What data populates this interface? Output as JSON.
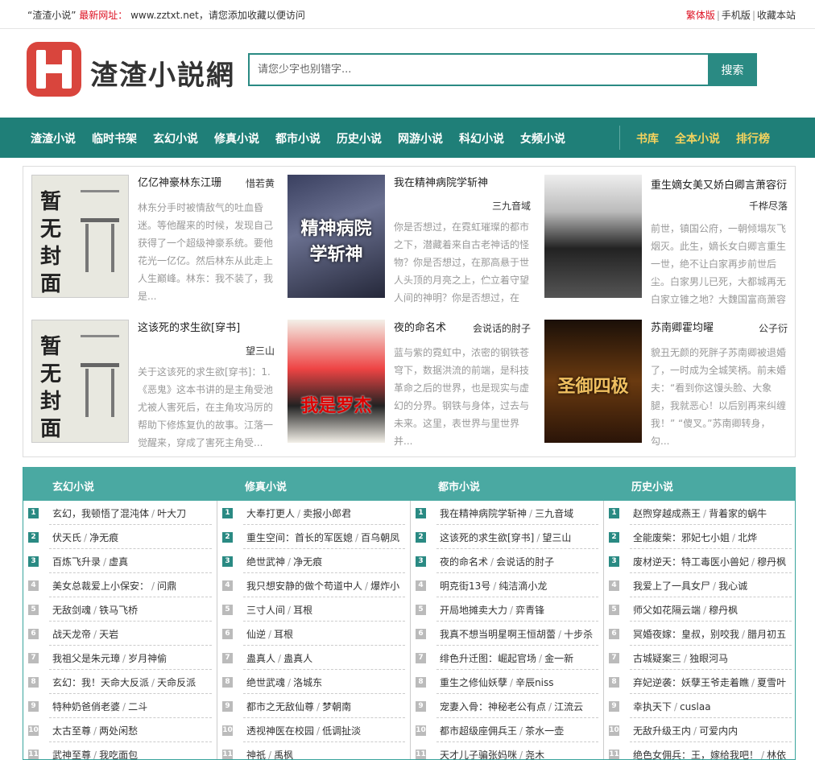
{
  "topbar": {
    "site_quote": "“渣渣小说”",
    "new_url_label": "最新网址：",
    "url_text": "www.zztxt.net，请您添加收藏以便访问",
    "links": [
      "繁体版",
      "手机版",
      "收藏本站"
    ]
  },
  "header": {
    "logo_letter": "H",
    "logo_text": "渣渣小説網",
    "search_placeholder": "请您少字也别错字...",
    "search_button": "搜索"
  },
  "nav": {
    "items": [
      "渣渣小说",
      "临时书架",
      "玄幻小说",
      "修真小说",
      "都市小说",
      "历史小说",
      "网游小说",
      "科幻小说",
      "女频小说"
    ],
    "right_items": [
      "书库",
      "全本小说",
      "排行榜"
    ]
  },
  "featured": [
    {
      "title": "亿亿神豪林东江珊",
      "author": "惜若黄",
      "cover": "暂无封面",
      "desc": "林东分手时被情敌气的吐血昏迷。等他醒来的时候，发现自己获得了一个超级神豪系统。要他花光一亿亿。然后林东从此走上人生巅峰。林东：我不装了，我是..."
    },
    {
      "title": "我在精神病院学斩神",
      "author": "三九音域",
      "cover": "精神病院学斩神",
      "desc": "你是否想过，在霓虹璀璨的都市之下，潜藏着来自古老神话的怪物？你是否想过，在那高悬于世人头顶的月亮之上，伫立着守望人间的神明？你是否想过，在"
    },
    {
      "title": "重生嫡女美又娇白卿言萧容衍",
      "author": "千桦尽落",
      "cover": "",
      "desc": "前世，镇国公府，一朝倾塌灰飞烟灭。此生，嫡长女白卿言重生一世，绝不让白家再步前世后尘。白家男儿已死，大都城再无白家立锥之地？大魏国富商萧容"
    },
    {
      "title": "这该死的求生欲[穿书]",
      "author": "望三山",
      "cover": "暂无封面",
      "desc": "关于这该死的求生欲[穿书]：1.《恶鬼》这本书讲的是主角受池尤被人害死后，在主角攻冯厉的帮助下修炼复仇的故事。江落一觉醒来，穿成了害死主角受..."
    },
    {
      "title": "夜的命名术",
      "author": "会说话的肘子",
      "cover": "我是罗杰",
      "desc": "蓝与紫的霓虹中，浓密的钢铁苍穹下，数据洪流的前端，是科技革命之后的世界，也是现实与虚幻的分界。钢铁与身体，过去与未来。这里，表世界与里世界并..."
    },
    {
      "title": "苏南卿霍均曜",
      "author": "公子衍",
      "cover": "圣御四极",
      "desc": "貌丑无颜的死胖子苏南卿被退婚了，一时成为全城笑柄。前未婚夫：“看到你这馒头脸、大象腿，我就恶心！以后别再来纠缠我！” “傻叉。”苏南卿转身，勾..."
    }
  ],
  "lists": [
    {
      "header": "玄幻小说",
      "rows": [
        [
          "玄幻，我顿悟了混沌体",
          "叶大刀"
        ],
        [
          "伏天氏",
          "净无痕"
        ],
        [
          "百炼飞升录",
          "虚真"
        ],
        [
          "美女总裁爱上小保安：",
          "问鼎"
        ],
        [
          "无敌剑魂",
          "铁马飞桥"
        ],
        [
          "战天龙帝",
          "天岩"
        ],
        [
          "我祖父是朱元璋",
          "岁月神偷"
        ],
        [
          "玄幻：我！天命大反派",
          "天命反派"
        ],
        [
          "特种奶爸俏老婆",
          "二斗"
        ],
        [
          "太古至尊",
          "两处闲愁"
        ],
        [
          "武神至尊",
          "我吃面包"
        ]
      ]
    },
    {
      "header": "修真小说",
      "rows": [
        [
          "大奉打更人",
          "卖报小郎君"
        ],
        [
          "重生空间：首长的军医媳",
          "百乌朝凤"
        ],
        [
          "绝世武神",
          "净无痕"
        ],
        [
          "我只想安静的做个苟道中人",
          "爆炸小"
        ],
        [
          "三寸人间",
          "耳根"
        ],
        [
          "仙逆",
          "耳根"
        ],
        [
          "蛊真人",
          "蛊真人"
        ],
        [
          "绝世武魂",
          "洛城东"
        ],
        [
          "都市之无敌仙尊",
          "梦朝南"
        ],
        [
          "透视神医在校园",
          "低调扯淡"
        ],
        [
          "神祇",
          "禹枫"
        ]
      ]
    },
    {
      "header": "都市小说",
      "rows": [
        [
          "我在精神病院学斩神",
          "三九音域"
        ],
        [
          "这该死的求生欲[穿书]",
          "望三山"
        ],
        [
          "夜的命名术",
          "会说话的肘子"
        ],
        [
          "明克街13号",
          "纯洁滴小龙"
        ],
        [
          "开局地摊卖大力",
          "弈青锋"
        ],
        [
          "我真不想当明星啊王恒胡蕾",
          "十步杀"
        ],
        [
          "绯色升迁图：崛起官场",
          "金一新"
        ],
        [
          "重生之修仙妖孽",
          "辛辰niss"
        ],
        [
          "宠妻入骨：神秘老公有点",
          "江流云"
        ],
        [
          "都市超级座佣兵王",
          "茶水一壶"
        ],
        [
          "天才儿子骗张妈咪",
          "尧木"
        ]
      ]
    },
    {
      "header": "历史小说",
      "rows": [
        [
          "赵煦穿越成燕王",
          "背着家的蜗牛"
        ],
        [
          "全能废柴：邪妃七小姐",
          "北烨"
        ],
        [
          "废材逆天：特工毒医小兽妃",
          "穆丹枫"
        ],
        [
          "我爱上了一具女尸",
          "我心诚"
        ],
        [
          "师父如花隔云端",
          "穆丹枫"
        ],
        [
          "冥婚夜嫁：皇叔，别咬我",
          "腊月初五"
        ],
        [
          "古城疑案三",
          "独眼河马"
        ],
        [
          "弃妃逆袭：妖孽王爷走着瞧",
          "夏雪叶"
        ],
        [
          "幸执天下",
          "cuslaa"
        ],
        [
          "无敌升级王内",
          "可爱内内"
        ],
        [
          "绝色女佣兵：王，嫁给我吧！",
          "林依"
        ]
      ]
    }
  ]
}
